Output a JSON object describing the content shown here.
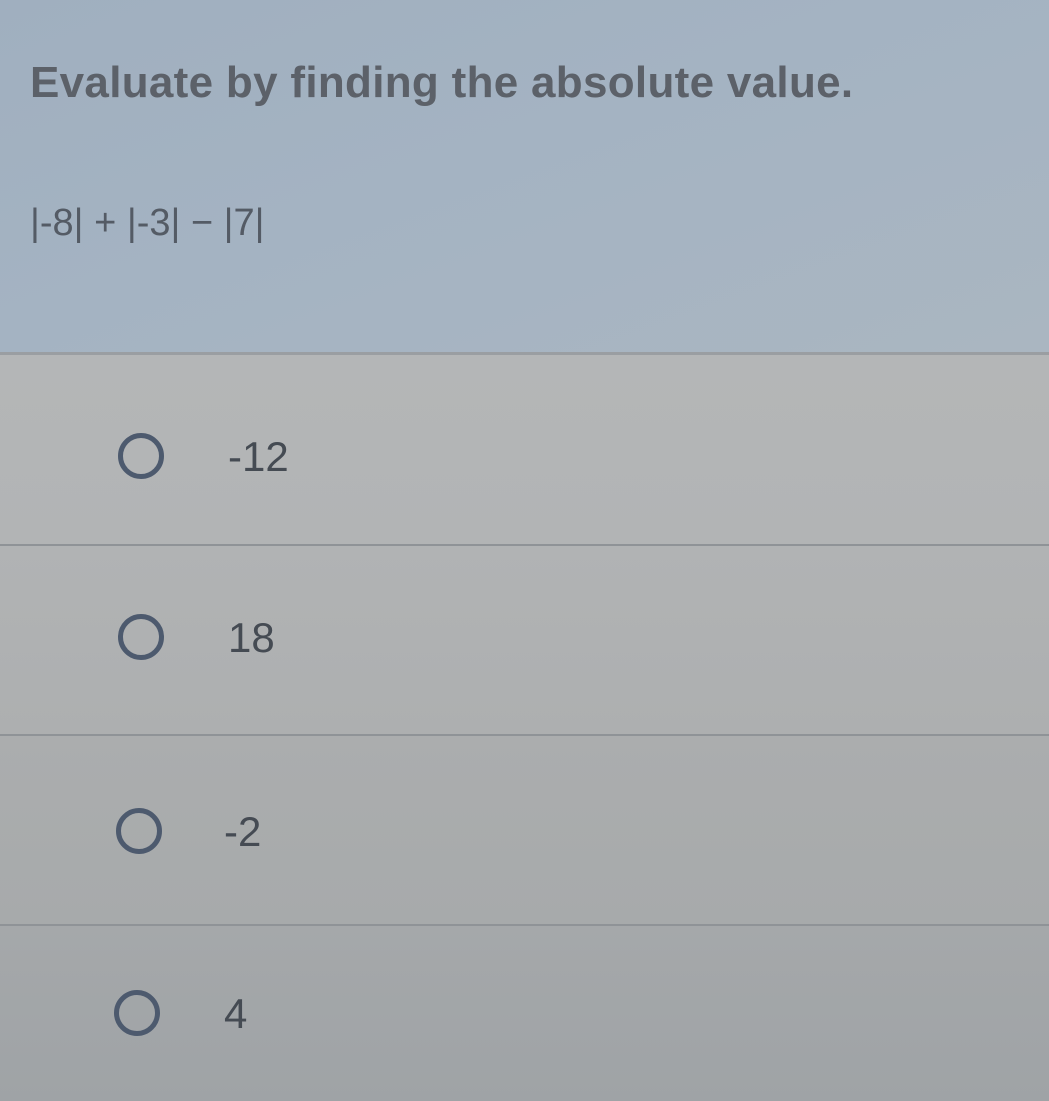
{
  "question": {
    "prompt": "Evaluate by finding the absolute value.",
    "expression": "|-8| + |-3| − |7|"
  },
  "options": [
    {
      "label": "-12",
      "selected": false
    },
    {
      "label": "18",
      "selected": false
    },
    {
      "label": "-2",
      "selected": false
    },
    {
      "label": "4",
      "selected": false
    }
  ],
  "colors": {
    "header_background": "#a4b3c2",
    "options_background": "#b0b2b3",
    "radio_border": "#4d5a6e",
    "prompt_text": "#5c6169"
  },
  "icons": {
    "radio": "radio-unchecked-icon"
  }
}
